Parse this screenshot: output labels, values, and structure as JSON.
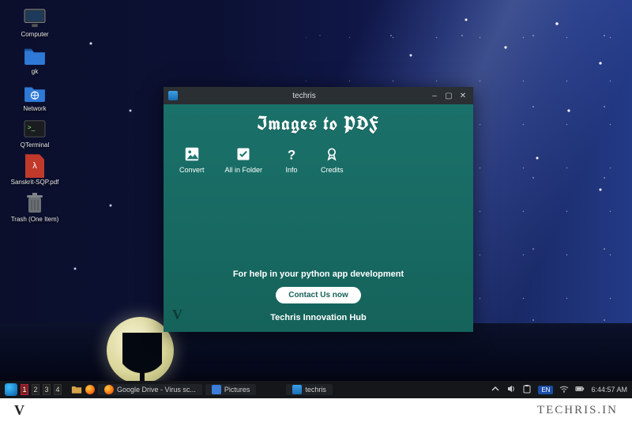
{
  "desktop": {
    "icons": [
      {
        "label": "Computer",
        "name": "desktop-icon-computer",
        "kind": "computer"
      },
      {
        "label": "gk",
        "name": "desktop-icon-gk",
        "kind": "folder"
      },
      {
        "label": "Network",
        "name": "desktop-icon-network",
        "kind": "folder"
      },
      {
        "label": "QTerminal",
        "name": "desktop-icon-qterminal",
        "kind": "terminal"
      },
      {
        "label": "Sanskrit-SQP.pdf",
        "name": "desktop-icon-sanskrit-pdf",
        "kind": "pdf"
      },
      {
        "label": "Trash (One Item)",
        "name": "desktop-icon-trash",
        "kind": "trash"
      }
    ]
  },
  "window": {
    "title": "techris",
    "app_title": "Images to PDF",
    "toolbar": [
      {
        "label": "Convert",
        "name": "convert-button",
        "icon": "image-icon"
      },
      {
        "label": "All in Folder",
        "name": "all-in-folder-button",
        "icon": "checkbox-icon"
      },
      {
        "label": "Info",
        "name": "info-button",
        "icon": "question-icon"
      },
      {
        "label": "Credits",
        "name": "credits-button",
        "icon": "badge-icon"
      }
    ],
    "help_text": "For help in your python app development",
    "cta_label": "Contact Us now",
    "hub_label": "Techris Innovation Hub"
  },
  "panel": {
    "workspaces": [
      "1",
      "2",
      "3",
      "4"
    ],
    "active_workspace": 0,
    "tasks": [
      {
        "label": "Google Drive - Virus sc...",
        "name": "task-firefox",
        "color": "#ff7a18"
      },
      {
        "label": "Pictures",
        "name": "task-pictures",
        "color": "#3b7dd8"
      },
      {
        "label": "techris",
        "name": "task-techris",
        "color": "#2fa6e0"
      }
    ],
    "lang": "EN",
    "clock": "6:44:57 AM"
  },
  "footer": {
    "logo_glyph": "V",
    "brand": "TECHRIS.IN"
  }
}
